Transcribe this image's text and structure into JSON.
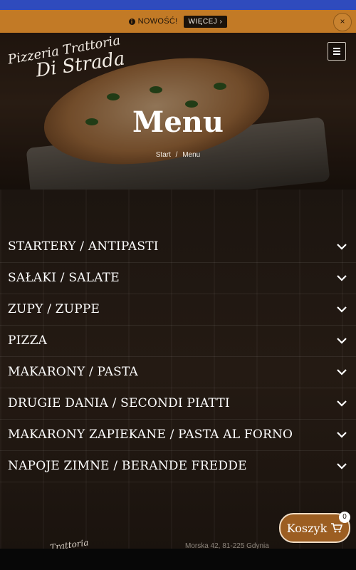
{
  "notice": {
    "label": "NOWOŚĆ!",
    "button": "WIĘCEJ ›",
    "close": "×"
  },
  "header": {
    "logo_line1": "Pizzeria Trattoria",
    "logo_line2": "Di Strada"
  },
  "hero": {
    "title": "Menu",
    "breadcrumb": [
      "Start",
      "/",
      "Menu"
    ]
  },
  "menu": {
    "items": [
      {
        "label": "STARTERY / ANTIPASTI"
      },
      {
        "label": "SAŁAKI / SALATE"
      },
      {
        "label": "ZUPY / ZUPPE"
      },
      {
        "label": "PIZZA"
      },
      {
        "label": "MAKARONY / PASTA"
      },
      {
        "label": "DRUGIE DANIA / SECONDI PIATTI"
      },
      {
        "label": "MAKARONY ZAPIEKANE / PASTA AL FORNO"
      },
      {
        "label": "NAPOJE ZIMNE / BERANDE FREDDE"
      }
    ]
  },
  "cart": {
    "label": "Koszyk",
    "count": "0"
  },
  "footer": {
    "logo": "Trattoria",
    "address": "Morska 42, 81-225 Gdynia"
  },
  "colors": {
    "notice_bg": "#c27a26",
    "top_bar": "#2f4bbd",
    "cart_bg": "#9c5e22"
  }
}
